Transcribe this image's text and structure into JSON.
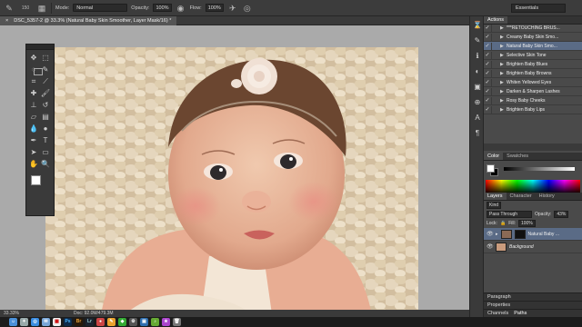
{
  "options_bar": {
    "mode_label": "Mode:",
    "mode_value": "Normal",
    "opacity_label": "Opacity:",
    "opacity_value": "100%",
    "flow_label": "Flow:",
    "flow_value": "100%",
    "brush_size": "150",
    "workspace": "Essentials"
  },
  "document": {
    "tab_title": "DSC_5357-2 @ 33.3% (Natural Baby Skin Smoother, Layer Mask/16) *",
    "close_glyph": "×"
  },
  "status_bar": {
    "zoom": "33.33%",
    "doc_size": "Doc: 92.0M/479.3M"
  },
  "tools": [
    {
      "name": "move-tool-icon",
      "glyph": "✥"
    },
    {
      "name": "marquee-tool-icon",
      "glyph": "⬚"
    },
    {
      "name": "lasso-tool-icon",
      "glyph": "◌"
    },
    {
      "name": "quick-select-tool-icon",
      "glyph": "✎"
    },
    {
      "name": "crop-tool-icon",
      "glyph": "⌗"
    },
    {
      "name": "eyedropper-tool-icon",
      "glyph": "⟋"
    },
    {
      "name": "healing-brush-tool-icon",
      "glyph": "✚"
    },
    {
      "name": "brush-tool-icon",
      "glyph": "🖌"
    },
    {
      "name": "clone-stamp-tool-icon",
      "glyph": "⊥"
    },
    {
      "name": "history-brush-tool-icon",
      "glyph": "↺"
    },
    {
      "name": "eraser-tool-icon",
      "glyph": "▱"
    },
    {
      "name": "gradient-tool-icon",
      "glyph": "▤"
    },
    {
      "name": "blur-tool-icon",
      "glyph": "💧"
    },
    {
      "name": "dodge-tool-icon",
      "glyph": "●"
    },
    {
      "name": "pen-tool-icon",
      "glyph": "✒"
    },
    {
      "name": "type-tool-icon",
      "glyph": "T"
    },
    {
      "name": "path-select-tool-icon",
      "glyph": "➤"
    },
    {
      "name": "shape-tool-icon",
      "glyph": "▭"
    },
    {
      "name": "hand-tool-icon",
      "glyph": "✋"
    },
    {
      "name": "zoom-tool-icon",
      "glyph": "🔍"
    }
  ],
  "actions_panel": {
    "tab": "Actions",
    "items": [
      {
        "label": "***RETOUCHING BRUS...",
        "selected": false
      },
      {
        "label": "Creamy Baby Skin Smo...",
        "selected": false
      },
      {
        "label": "Natural Baby Skin Smo...",
        "selected": true
      },
      {
        "label": "Selective Skin Tone",
        "selected": false
      },
      {
        "label": "Brighten Baby Blues",
        "selected": false
      },
      {
        "label": "Brighten Baby Browns",
        "selected": false
      },
      {
        "label": "Whiten Yellowed Eyes",
        "selected": false
      },
      {
        "label": "Darken & Sharpen Lashes",
        "selected": false
      },
      {
        "label": "Rosy Baby Cheeks",
        "selected": false
      },
      {
        "label": "Brighten Baby Lips",
        "selected": false
      }
    ]
  },
  "color_panel": {
    "tabs": [
      "Color",
      "Swatches"
    ]
  },
  "layers_panel": {
    "tabs": [
      "Layers",
      "Character",
      "History"
    ],
    "kind_label": "Kind",
    "blend_mode": "Pass Through",
    "opacity_label": "Opacity:",
    "opacity_value": "43%",
    "lock_label": "Lock:",
    "fill_label": "Fill:",
    "fill_value": "100%",
    "layers": [
      {
        "name": "Natural Baby ...",
        "selected": true
      },
      {
        "name": "Background",
        "selected": false
      }
    ]
  },
  "collapsed_panels": {
    "paragraph": "Paragraph",
    "properties": "Properties",
    "channels": "Channels",
    "paths": "Paths"
  },
  "colors": {
    "selection": "#5a6b86",
    "canvas_bg": "#aaaaaa",
    "panel_bg": "#4a4a4a"
  }
}
